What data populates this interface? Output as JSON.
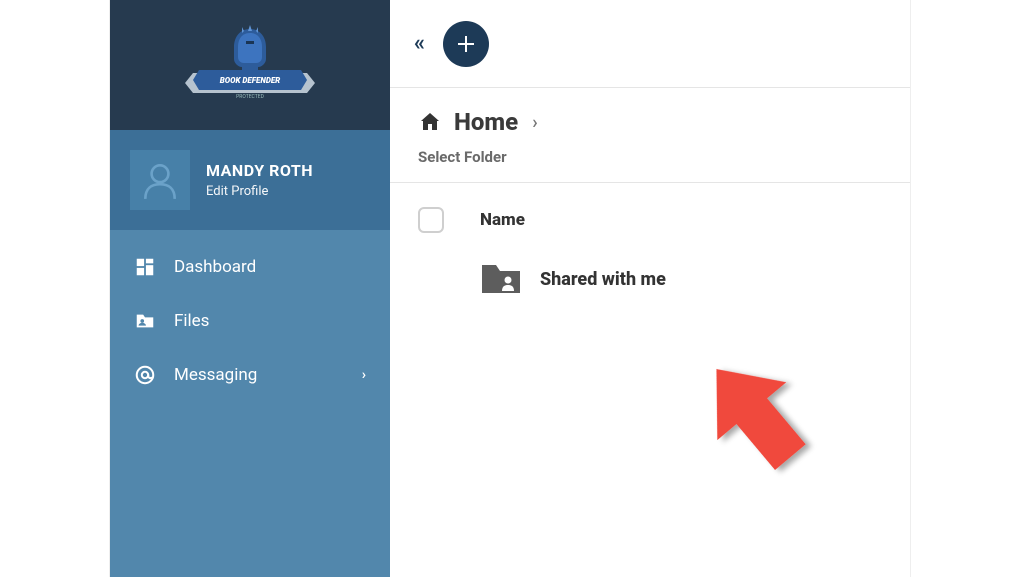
{
  "logo": {
    "brand_top": "BOOK DEFENDER",
    "brand_bottom": "PROTECTED"
  },
  "profile": {
    "name": "MANDY ROTH",
    "sublabel": "Edit Profile"
  },
  "sidebar": {
    "items": [
      {
        "label": "Dashboard",
        "has_chevron": false
      },
      {
        "label": "Files",
        "has_chevron": false
      },
      {
        "label": "Messaging",
        "has_chevron": true
      }
    ]
  },
  "topbar": {
    "collapse_glyph": "«",
    "add_tooltip": "Add"
  },
  "breadcrumb": {
    "title": "Home",
    "separator": "›",
    "subtitle": "Select Folder"
  },
  "list": {
    "columns": {
      "name": "Name"
    },
    "rows": [
      {
        "label": "Shared with me"
      }
    ]
  },
  "colors": {
    "sidebar_bg": "#5287ac",
    "sidebar_header": "#263a4f",
    "profile_bg": "#3c6f97",
    "accent_dark": "#1d3a57",
    "annotation_arrow": "#f04a3e"
  }
}
